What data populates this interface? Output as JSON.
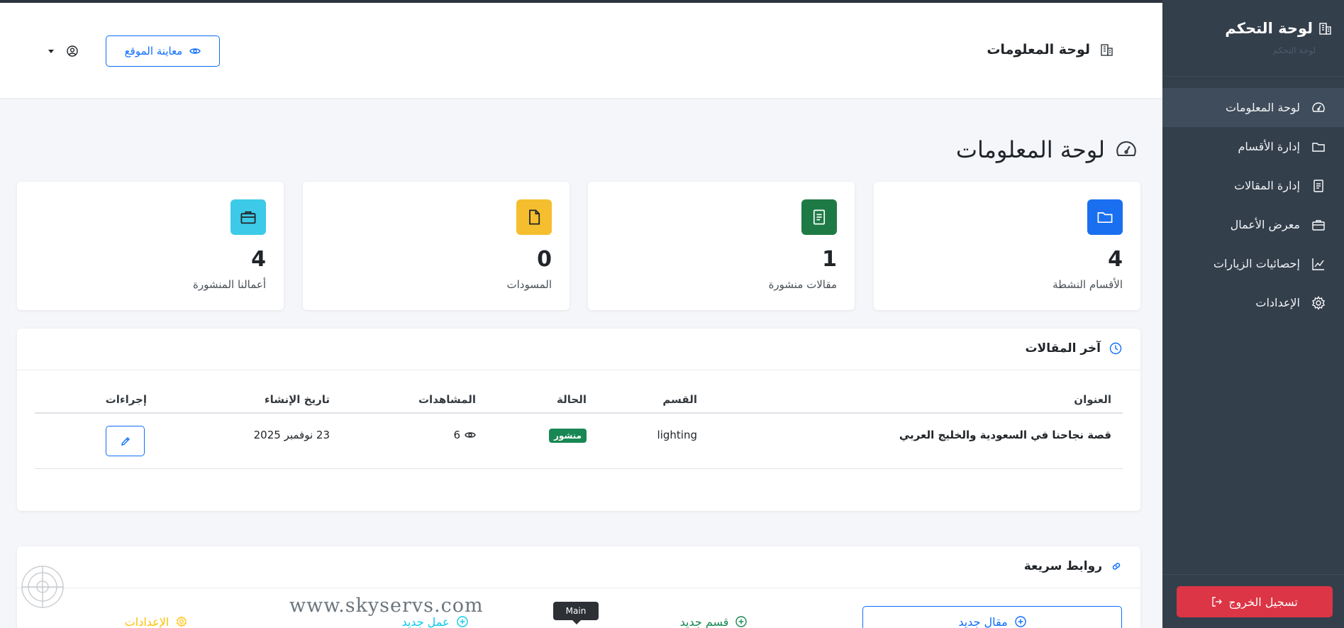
{
  "sidebar": {
    "brand_title": "لوحة التحكم",
    "brand_subtitle": "لوحة التحكم",
    "items": [
      {
        "label": "لوحة المعلومات",
        "icon": "speedometer-icon",
        "active": true
      },
      {
        "label": "إدارة الأقسام",
        "icon": "folder-icon"
      },
      {
        "label": "إدارة المقالات",
        "icon": "document-icon"
      },
      {
        "label": "معرض الأعمال",
        "icon": "briefcase-icon"
      },
      {
        "label": "إحصائيات الزيارات",
        "icon": "chart-line-icon"
      },
      {
        "label": "الإعدادات",
        "icon": "gear-icon"
      }
    ],
    "logout_label": "تسجيل الخروج"
  },
  "header": {
    "title": "لوحة المعلومات",
    "preview_label": "معاينة الموقع"
  },
  "page": {
    "title": "لوحة المعلومات"
  },
  "stats": [
    {
      "value": "4",
      "label": "الأقسام النشطة",
      "color": "#1a6ff0",
      "icon": "folder-icon"
    },
    {
      "value": "1",
      "label": "مقالات منشورة",
      "color": "#1e7a45",
      "icon": "document-icon"
    },
    {
      "value": "0",
      "label": "المسودات",
      "color": "#f5be2e",
      "icon": "file-icon"
    },
    {
      "value": "4",
      "label": "أعمالنا المنشورة",
      "color": "#3dcae8",
      "icon": "briefcase-icon"
    }
  ],
  "latest_articles": {
    "title": "آخر المقالات",
    "columns": {
      "title": "العنوان",
      "section": "القسم",
      "status": "الحالة",
      "views": "المشاهدات",
      "created": "تاريخ الإنشاء",
      "actions": "إجراءات"
    },
    "rows": [
      {
        "title": "قصة نجاحنا في السعودية والخليج العربي",
        "section": "lighting",
        "status": "منشور",
        "views": "6",
        "created": "23 نوفمبر 2025"
      }
    ]
  },
  "quick_links": {
    "title": "روابط سريعة",
    "items": [
      {
        "label": "مقال جديد",
        "color": "#0d6efd"
      },
      {
        "label": "قسم جديد",
        "color": "#198754"
      },
      {
        "label": "عمل جديد",
        "color": "#0dcaf0"
      },
      {
        "label": "الإعدادات",
        "color": "#ffc107"
      }
    ]
  },
  "overlay": {
    "watermark": "www.skyservs.com",
    "tooltip": "Main"
  },
  "colors": {
    "sidebar_bg": "#343f4c",
    "accent": "#0d6efd",
    "danger": "#dc3545",
    "success": "#198754"
  }
}
